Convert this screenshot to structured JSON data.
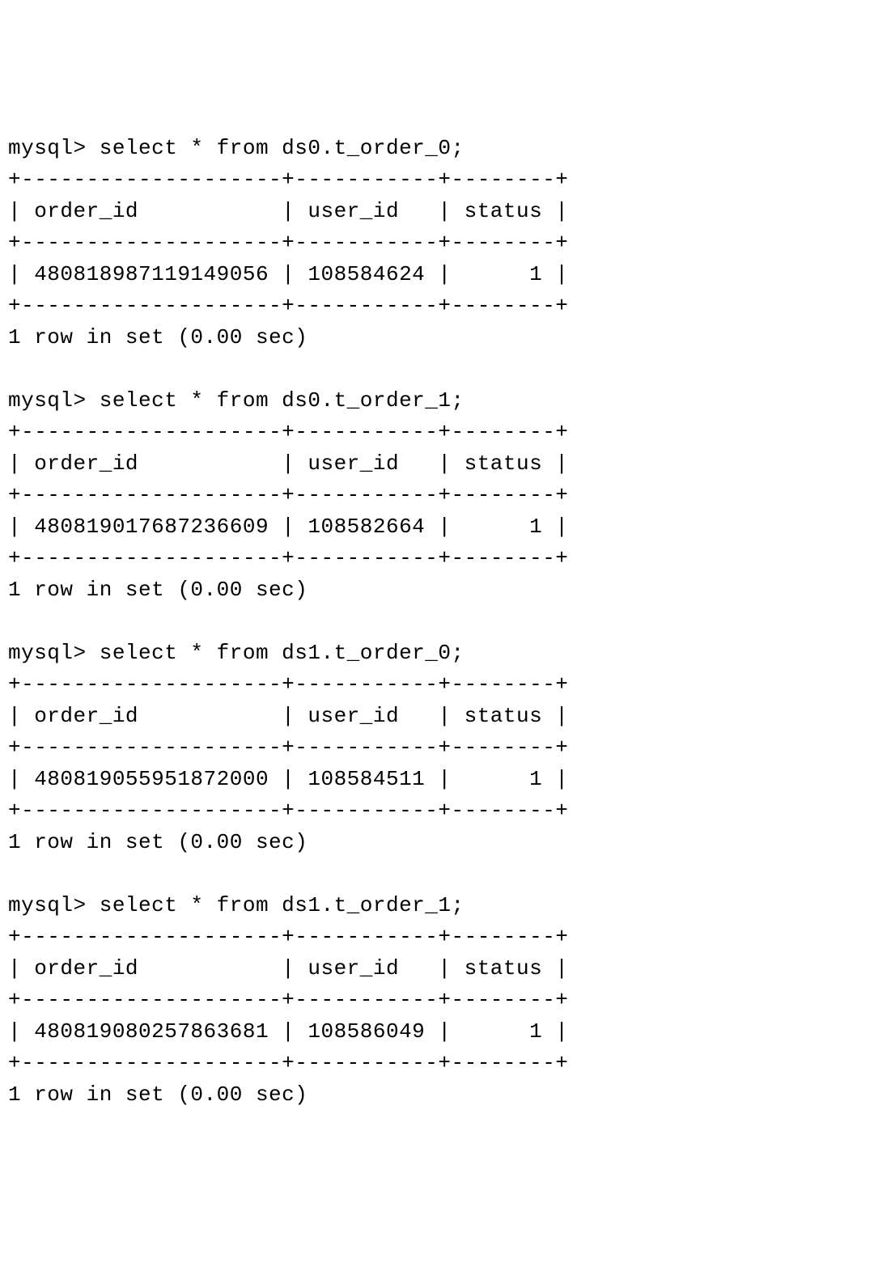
{
  "prompt": "mysql> ",
  "queries": [
    {
      "sql": "select * from ds0.t_order_0;",
      "columns": [
        "order_id",
        "user_id",
        "status"
      ],
      "widths": [
        20,
        11,
        8
      ],
      "rows": [
        {
          "order_id": "480818987119149056",
          "user_id": "108584624",
          "status": "1"
        }
      ],
      "summary": "1 row in set (0.00 sec)"
    },
    {
      "sql": "select * from ds0.t_order_1;",
      "columns": [
        "order_id",
        "user_id",
        "status"
      ],
      "widths": [
        20,
        11,
        8
      ],
      "rows": [
        {
          "order_id": "480819017687236609",
          "user_id": "108582664",
          "status": "1"
        }
      ],
      "summary": "1 row in set (0.00 sec)"
    },
    {
      "sql": "select * from ds1.t_order_0;",
      "columns": [
        "order_id",
        "user_id",
        "status"
      ],
      "widths": [
        20,
        11,
        8
      ],
      "rows": [
        {
          "order_id": "480819055951872000",
          "user_id": "108584511",
          "status": "1"
        }
      ],
      "summary": "1 row in set (0.00 sec)"
    },
    {
      "sql": "select * from ds1.t_order_1;",
      "columns": [
        "order_id",
        "user_id",
        "status"
      ],
      "widths": [
        20,
        11,
        8
      ],
      "rows": [
        {
          "order_id": "480819080257863681",
          "user_id": "108586049",
          "status": "1"
        }
      ],
      "summary": "1 row in set (0.00 sec)"
    }
  ]
}
